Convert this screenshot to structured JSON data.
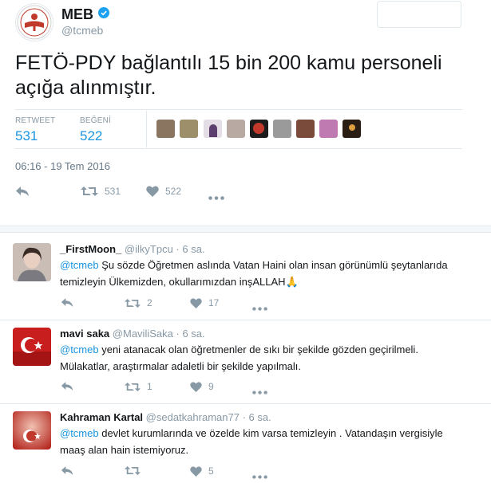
{
  "header": {
    "name": "MEB",
    "handle": "@tcmeb"
  },
  "tweet": {
    "text": "FETÖ-PDY bağlantılı 15 bin 200 kamu personeli açığa alınmıştır.",
    "stats": {
      "retweet_label": "RETWEET",
      "retweet_count": "531",
      "like_label": "BEĞENİ",
      "like_count": "522"
    },
    "timestamp": "06:16 - 19 Tem 2016",
    "actions": {
      "retweets": "531",
      "likes": "522"
    }
  },
  "replies": [
    {
      "name": "_FirstMoon_",
      "handle": "@ilkyTpcu",
      "time": "6 sa.",
      "mention": "@tcmeb",
      "text": " Şu sözde Öğretmen aslında Vatan Haini olan insan görünümlü şeytanlarıda temizleyin Ülkemizden, okullarımızdan inşALLAH🙏",
      "retweets": "2",
      "likes": "17"
    },
    {
      "name": "mavi saka",
      "handle": "@MaviliSaka",
      "time": "6 sa.",
      "mention": "@tcmeb",
      "text": " yeni atanacak olan öğretmenler de sıkı bir şekilde gözden geçirilmeli. Mülakatlar, araştırmalar adaletli bir şekilde yapılmalı.",
      "retweets": "1",
      "likes": "9"
    },
    {
      "name": "Kahraman Kartal",
      "handle": "@sedatkahraman77",
      "time": "6 sa.",
      "mention": "@tcmeb",
      "text": " devlet kurumlarında ve özelde kim varsa temizleyin . Vatandaşın vergisiyle maaş alan hain istemiyoruz.",
      "retweets": "",
      "likes": "5"
    }
  ],
  "colors": {
    "link": "#1b95e0",
    "muted": "#8899a6",
    "text": "#14171a",
    "border": "#e1e8ed"
  }
}
